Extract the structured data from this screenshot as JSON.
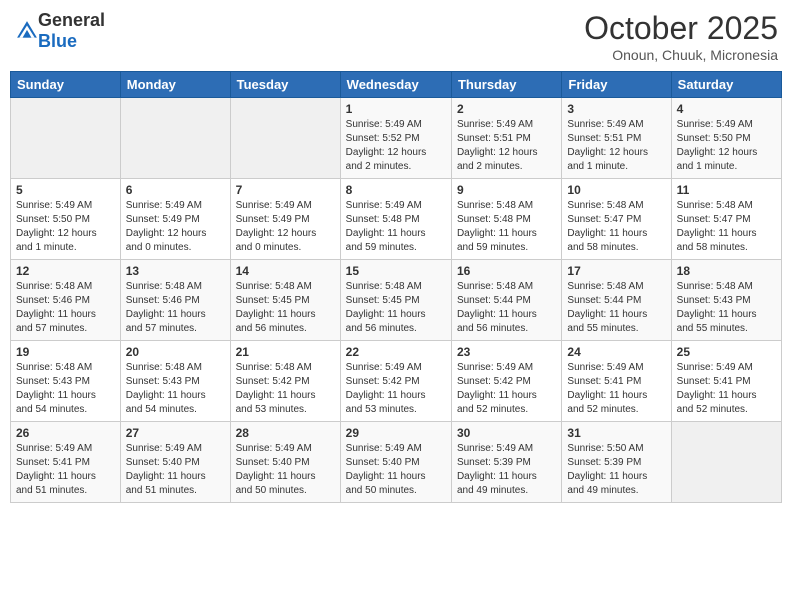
{
  "header": {
    "logo_general": "General",
    "logo_blue": "Blue",
    "month_title": "October 2025",
    "location": "Onoun, Chuuk, Micronesia"
  },
  "weekdays": [
    "Sunday",
    "Monday",
    "Tuesday",
    "Wednesday",
    "Thursday",
    "Friday",
    "Saturday"
  ],
  "weeks": [
    [
      {
        "day": "",
        "info": ""
      },
      {
        "day": "",
        "info": ""
      },
      {
        "day": "",
        "info": ""
      },
      {
        "day": "1",
        "info": "Sunrise: 5:49 AM\nSunset: 5:52 PM\nDaylight: 12 hours\nand 2 minutes."
      },
      {
        "day": "2",
        "info": "Sunrise: 5:49 AM\nSunset: 5:51 PM\nDaylight: 12 hours\nand 2 minutes."
      },
      {
        "day": "3",
        "info": "Sunrise: 5:49 AM\nSunset: 5:51 PM\nDaylight: 12 hours\nand 1 minute."
      },
      {
        "day": "4",
        "info": "Sunrise: 5:49 AM\nSunset: 5:50 PM\nDaylight: 12 hours\nand 1 minute."
      }
    ],
    [
      {
        "day": "5",
        "info": "Sunrise: 5:49 AM\nSunset: 5:50 PM\nDaylight: 12 hours\nand 1 minute."
      },
      {
        "day": "6",
        "info": "Sunrise: 5:49 AM\nSunset: 5:49 PM\nDaylight: 12 hours\nand 0 minutes."
      },
      {
        "day": "7",
        "info": "Sunrise: 5:49 AM\nSunset: 5:49 PM\nDaylight: 12 hours\nand 0 minutes."
      },
      {
        "day": "8",
        "info": "Sunrise: 5:49 AM\nSunset: 5:48 PM\nDaylight: 11 hours\nand 59 minutes."
      },
      {
        "day": "9",
        "info": "Sunrise: 5:48 AM\nSunset: 5:48 PM\nDaylight: 11 hours\nand 59 minutes."
      },
      {
        "day": "10",
        "info": "Sunrise: 5:48 AM\nSunset: 5:47 PM\nDaylight: 11 hours\nand 58 minutes."
      },
      {
        "day": "11",
        "info": "Sunrise: 5:48 AM\nSunset: 5:47 PM\nDaylight: 11 hours\nand 58 minutes."
      }
    ],
    [
      {
        "day": "12",
        "info": "Sunrise: 5:48 AM\nSunset: 5:46 PM\nDaylight: 11 hours\nand 57 minutes."
      },
      {
        "day": "13",
        "info": "Sunrise: 5:48 AM\nSunset: 5:46 PM\nDaylight: 11 hours\nand 57 minutes."
      },
      {
        "day": "14",
        "info": "Sunrise: 5:48 AM\nSunset: 5:45 PM\nDaylight: 11 hours\nand 56 minutes."
      },
      {
        "day": "15",
        "info": "Sunrise: 5:48 AM\nSunset: 5:45 PM\nDaylight: 11 hours\nand 56 minutes."
      },
      {
        "day": "16",
        "info": "Sunrise: 5:48 AM\nSunset: 5:44 PM\nDaylight: 11 hours\nand 56 minutes."
      },
      {
        "day": "17",
        "info": "Sunrise: 5:48 AM\nSunset: 5:44 PM\nDaylight: 11 hours\nand 55 minutes."
      },
      {
        "day": "18",
        "info": "Sunrise: 5:48 AM\nSunset: 5:43 PM\nDaylight: 11 hours\nand 55 minutes."
      }
    ],
    [
      {
        "day": "19",
        "info": "Sunrise: 5:48 AM\nSunset: 5:43 PM\nDaylight: 11 hours\nand 54 minutes."
      },
      {
        "day": "20",
        "info": "Sunrise: 5:48 AM\nSunset: 5:43 PM\nDaylight: 11 hours\nand 54 minutes."
      },
      {
        "day": "21",
        "info": "Sunrise: 5:48 AM\nSunset: 5:42 PM\nDaylight: 11 hours\nand 53 minutes."
      },
      {
        "day": "22",
        "info": "Sunrise: 5:49 AM\nSunset: 5:42 PM\nDaylight: 11 hours\nand 53 minutes."
      },
      {
        "day": "23",
        "info": "Sunrise: 5:49 AM\nSunset: 5:42 PM\nDaylight: 11 hours\nand 52 minutes."
      },
      {
        "day": "24",
        "info": "Sunrise: 5:49 AM\nSunset: 5:41 PM\nDaylight: 11 hours\nand 52 minutes."
      },
      {
        "day": "25",
        "info": "Sunrise: 5:49 AM\nSunset: 5:41 PM\nDaylight: 11 hours\nand 52 minutes."
      }
    ],
    [
      {
        "day": "26",
        "info": "Sunrise: 5:49 AM\nSunset: 5:41 PM\nDaylight: 11 hours\nand 51 minutes."
      },
      {
        "day": "27",
        "info": "Sunrise: 5:49 AM\nSunset: 5:40 PM\nDaylight: 11 hours\nand 51 minutes."
      },
      {
        "day": "28",
        "info": "Sunrise: 5:49 AM\nSunset: 5:40 PM\nDaylight: 11 hours\nand 50 minutes."
      },
      {
        "day": "29",
        "info": "Sunrise: 5:49 AM\nSunset: 5:40 PM\nDaylight: 11 hours\nand 50 minutes."
      },
      {
        "day": "30",
        "info": "Sunrise: 5:49 AM\nSunset: 5:39 PM\nDaylight: 11 hours\nand 49 minutes."
      },
      {
        "day": "31",
        "info": "Sunrise: 5:50 AM\nSunset: 5:39 PM\nDaylight: 11 hours\nand 49 minutes."
      },
      {
        "day": "",
        "info": ""
      }
    ]
  ]
}
